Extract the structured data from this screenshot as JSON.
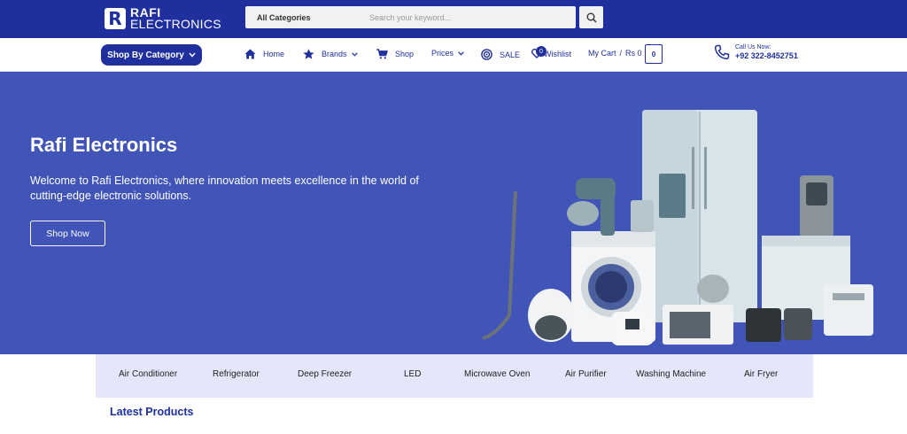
{
  "brand": {
    "mark": "R",
    "line1": "RAFI",
    "line2": "ELECTRONICS"
  },
  "search": {
    "category": "All Categories",
    "placeholder": "Search your keyword...",
    "icon": "search-icon"
  },
  "nav": {
    "shop_by_category": "Shop By Category",
    "items": [
      {
        "label": "Home",
        "icon": "home-icon"
      },
      {
        "label": "Brands",
        "icon": "star-icon"
      },
      {
        "label": "Shop",
        "icon": "cart-icon"
      },
      {
        "label": "Prices",
        "icon": ""
      },
      {
        "label": "SALE",
        "icon": "target-icon"
      },
      {
        "label": "Wishlist",
        "icon": "heart-icon",
        "badge": "0"
      }
    ],
    "cart": {
      "label": "My Cart",
      "sep": "/",
      "amount": "Rs 0",
      "count": "0"
    },
    "call": {
      "label": "Call Us Now:",
      "number": "+92 322-8452751"
    }
  },
  "hero": {
    "title": "Rafi Electronics",
    "text": "Welcome to Rafi Electronics, where innovation meets excellence in the world of cutting-edge electronic solutions.",
    "button": "Shop Now"
  },
  "categories": [
    "Air Conditioner",
    "Refrigerator",
    "Deep Freezer",
    "LED",
    "Microwave Oven",
    "Air Purifier",
    "Washing Machine",
    "Air Fryer"
  ],
  "sections": {
    "latest": "Latest Products"
  },
  "colors": {
    "primary": "#1f2f9e",
    "hero_bg": "#4155b8",
    "strip_bg": "#e6e6fa"
  }
}
